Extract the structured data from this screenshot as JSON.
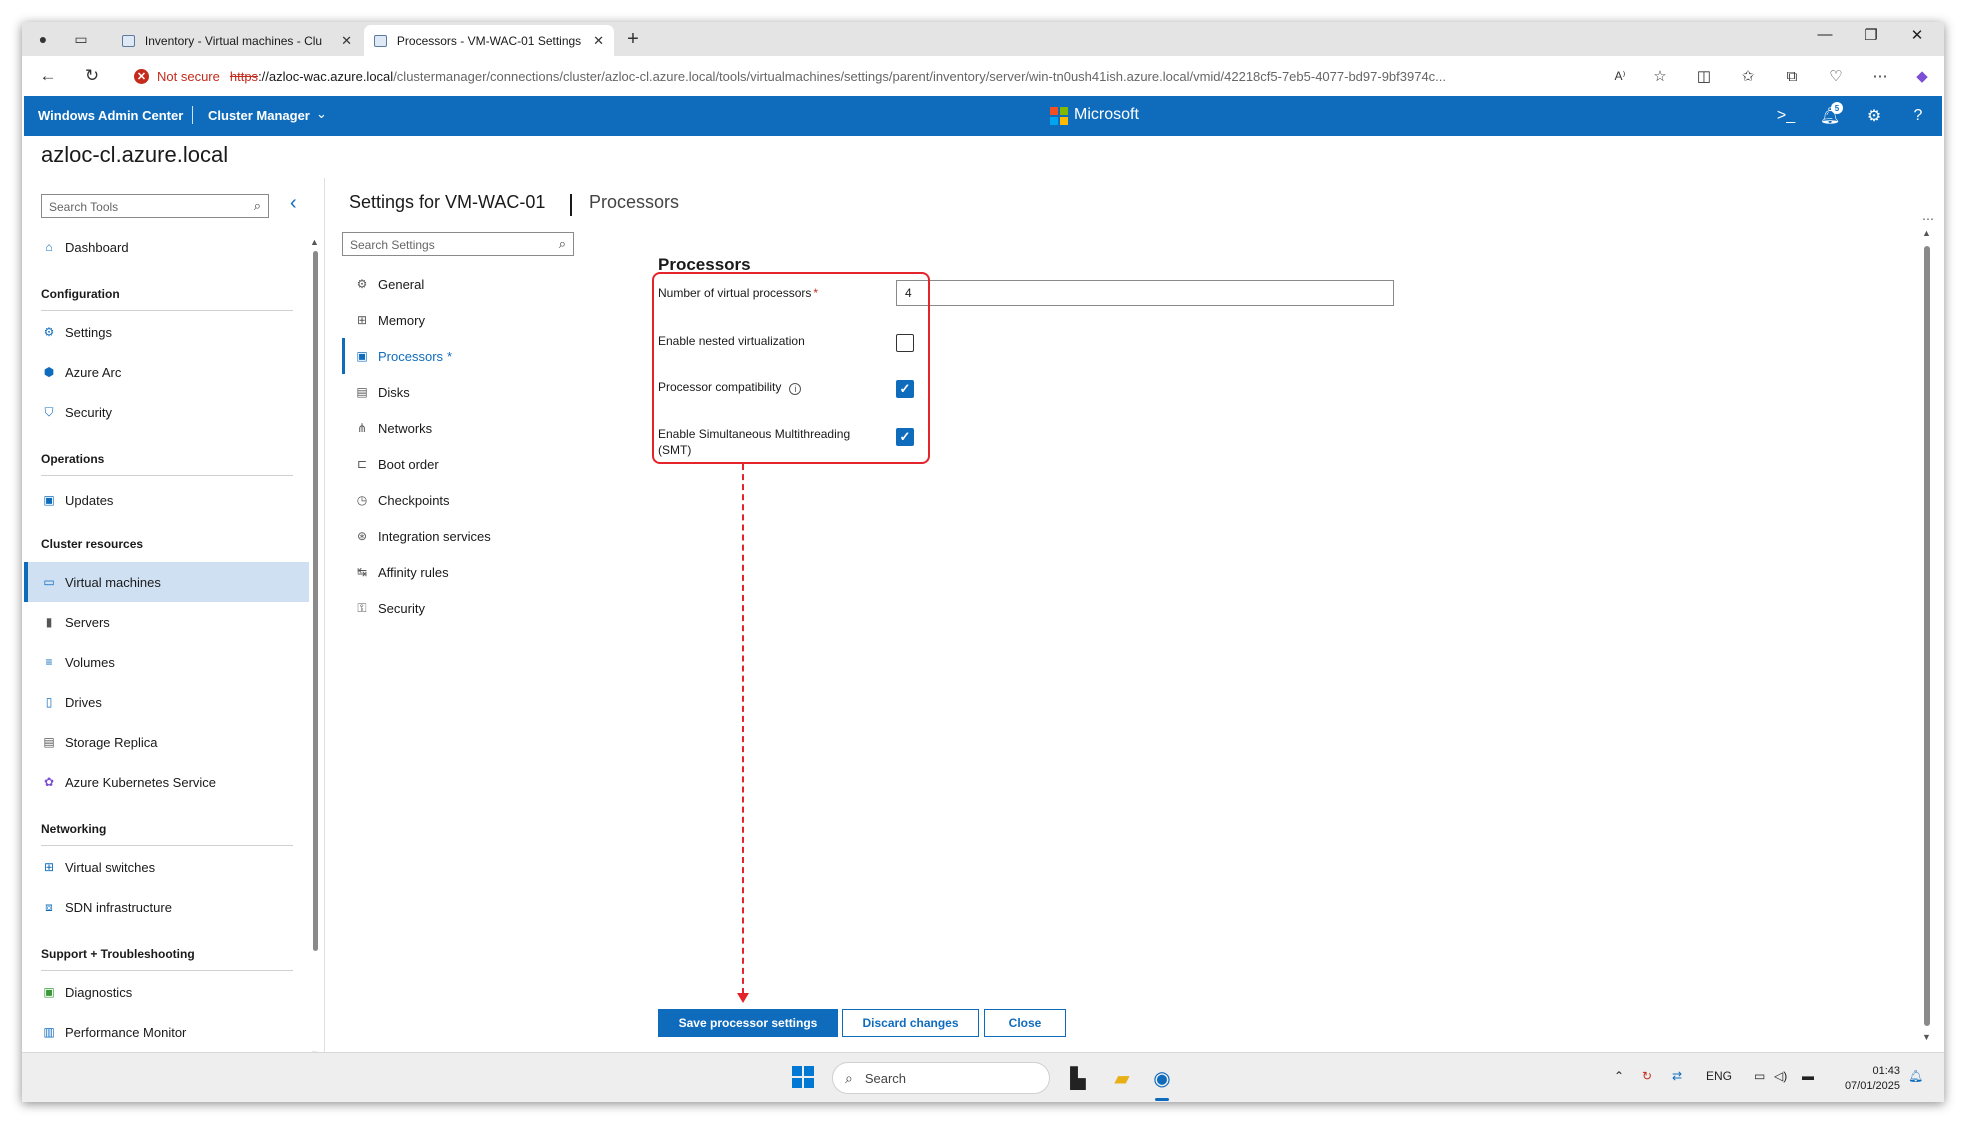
{
  "browser": {
    "tabs": [
      {
        "label": "Inventory - Virtual machines - Clu",
        "active": false
      },
      {
        "label": "Processors - VM-WAC-01 Settings",
        "active": true
      }
    ],
    "security_label": "Not secure",
    "url_scheme": "https",
    "url_host": "://azloc-wac.azure.local",
    "url_path": "/clustermanager/connections/cluster/azloc-cl.azure.local/tools/virtualmachines/settings/parent/inventory/server/win-tn0ush41ish.azure.local/vmid/42218cf5-7eb5-4077-bd97-9bf3974c..."
  },
  "header": {
    "app_name": "Windows Admin Center",
    "tool_name": "Cluster Manager",
    "brand": "Microsoft",
    "notification_count": "5"
  },
  "cluster_name": "azloc-cl.azure.local",
  "left_nav": {
    "search_placeholder": "Search Tools",
    "dashboard": "Dashboard",
    "sections": [
      {
        "title": "Configuration",
        "items": [
          "Settings",
          "Azure Arc",
          "Security"
        ]
      },
      {
        "title": "Operations",
        "items": [
          "Updates"
        ]
      },
      {
        "title": "Cluster resources",
        "items": [
          "Virtual machines",
          "Servers",
          "Volumes",
          "Drives",
          "Storage Replica",
          "Azure Kubernetes Service"
        ]
      },
      {
        "title": "Networking",
        "items": [
          "Virtual switches",
          "SDN infrastructure"
        ]
      },
      {
        "title": "Support + Troubleshooting",
        "items": [
          "Diagnostics",
          "Performance Monitor"
        ]
      }
    ],
    "selected": "Virtual machines"
  },
  "settings": {
    "title": "Settings for VM-WAC-01",
    "subtitle": "Processors",
    "search_placeholder": "Search Settings",
    "items": [
      "General",
      "Memory",
      "Processors",
      "Disks",
      "Networks",
      "Boot order",
      "Checkpoints",
      "Integration services",
      "Affinity rules",
      "Security"
    ],
    "selected": "Processors",
    "dirty_marker": "*"
  },
  "processors": {
    "heading": "Processors",
    "num_vp_label": "Number of virtual processors",
    "required_marker": "*",
    "num_vp_value": "4",
    "nested_label": "Enable nested virtualization",
    "nested_checked": false,
    "compat_label": "Processor compatibility",
    "compat_checked": true,
    "smt_label": "Enable Simultaneous Multithreading (SMT)",
    "smt_checked": true
  },
  "actions": {
    "save": "Save processor settings",
    "discard": "Discard changes",
    "close": "Close"
  },
  "taskbar": {
    "search_placeholder": "Search",
    "lang": "ENG",
    "time": "01:43",
    "date": "07/01/2025"
  },
  "colors": {
    "accent": "#0f6cbd",
    "highlight_box": "#e3242b",
    "selected_nav_bg": "#cfe0f2"
  }
}
